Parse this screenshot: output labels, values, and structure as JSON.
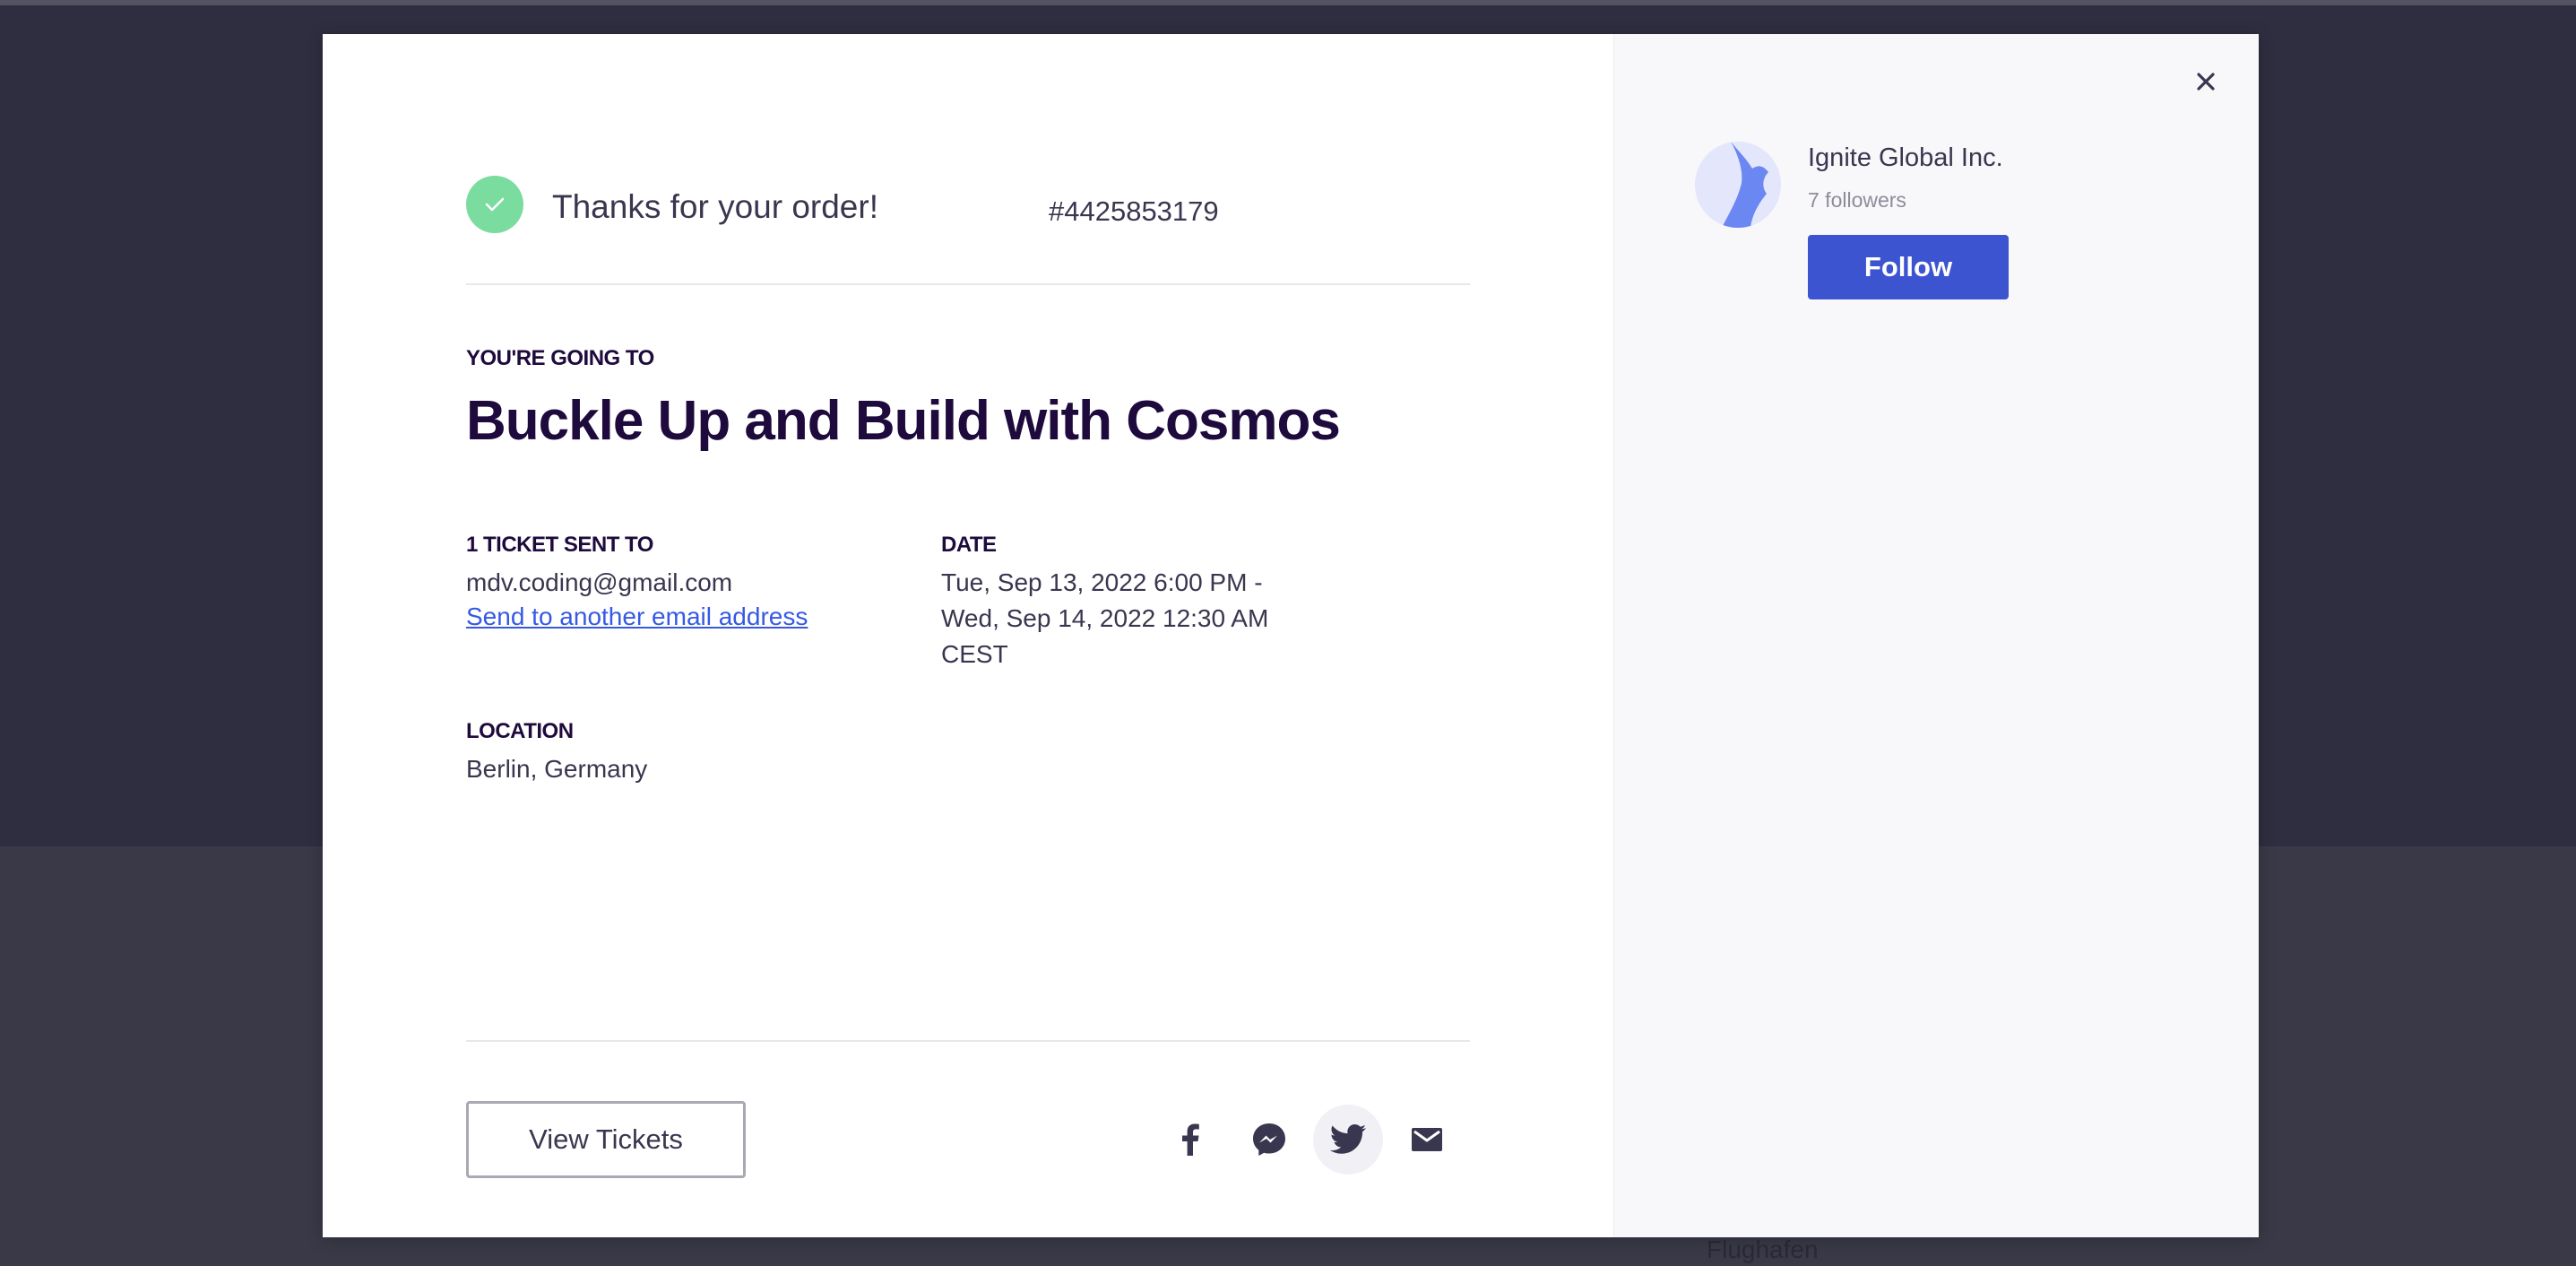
{
  "background": {
    "ghost_text": "Flughafen"
  },
  "confirmation": {
    "thanks_text": "Thanks for your order!",
    "order_number": "#4425853179"
  },
  "event": {
    "going_label": "YOU'RE GOING TO",
    "title": "Buckle Up and Build with Cosmos"
  },
  "tickets": {
    "label": "1 TICKET SENT TO",
    "email": "mdv.coding@gmail.com",
    "send_another_link": "Send to another email address"
  },
  "date": {
    "label": "DATE",
    "line1": "Tue, Sep 13, 2022 6:00 PM -",
    "line2": "Wed, Sep 14, 2022 12:30 AM",
    "line3": "CEST"
  },
  "location": {
    "label": "LOCATION",
    "value": "Berlin, Germany"
  },
  "actions": {
    "view_tickets_label": "View Tickets",
    "share_icons": [
      "facebook-icon",
      "messenger-icon",
      "twitter-icon",
      "email-icon"
    ]
  },
  "organizer": {
    "name": "Ignite Global Inc.",
    "followers": "7 followers",
    "follow_label": "Follow"
  },
  "colors": {
    "success": "#7bdc9f",
    "link": "#3659e3",
    "primary_button": "#3d54d1",
    "heading": "#1e0a3c"
  }
}
